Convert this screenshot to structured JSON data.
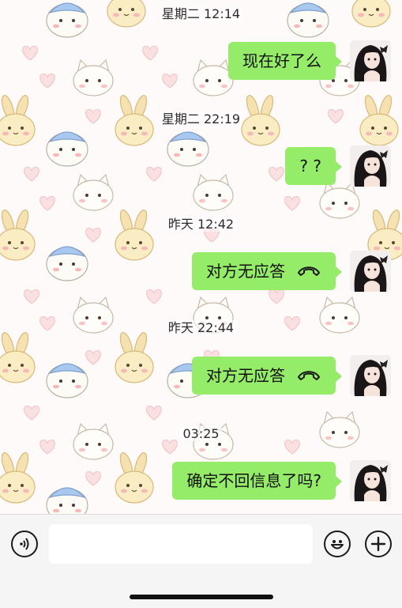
{
  "theme": {
    "bubble_color": "#95ec69",
    "wallpaper_color": "#fffafa",
    "input_bar_color": "#f5f5f5"
  },
  "messages": [
    {
      "timestamp": "星期二 12:14",
      "text": "现在好了么",
      "type": "text"
    },
    {
      "timestamp": "星期二 22:19",
      "text": "? ?",
      "type": "text"
    },
    {
      "timestamp": "昨天 12:42",
      "text": "对方无应答",
      "type": "voice-call",
      "icon": "hangup-phone-icon"
    },
    {
      "timestamp": "昨天 22:44",
      "text": "对方无应答",
      "type": "voice-call",
      "icon": "hangup-phone-icon"
    },
    {
      "timestamp": "03:25",
      "text": "确定不回信息了吗?",
      "type": "text"
    }
  ],
  "input_bar": {
    "placeholder": "",
    "voice_icon": "voice-input-icon",
    "emoji_icon": "emoji-icon",
    "more_icon": "plus-icon"
  },
  "wallpaper": {
    "stickers": [
      "bunny",
      "hamster",
      "cat",
      "heart"
    ]
  }
}
